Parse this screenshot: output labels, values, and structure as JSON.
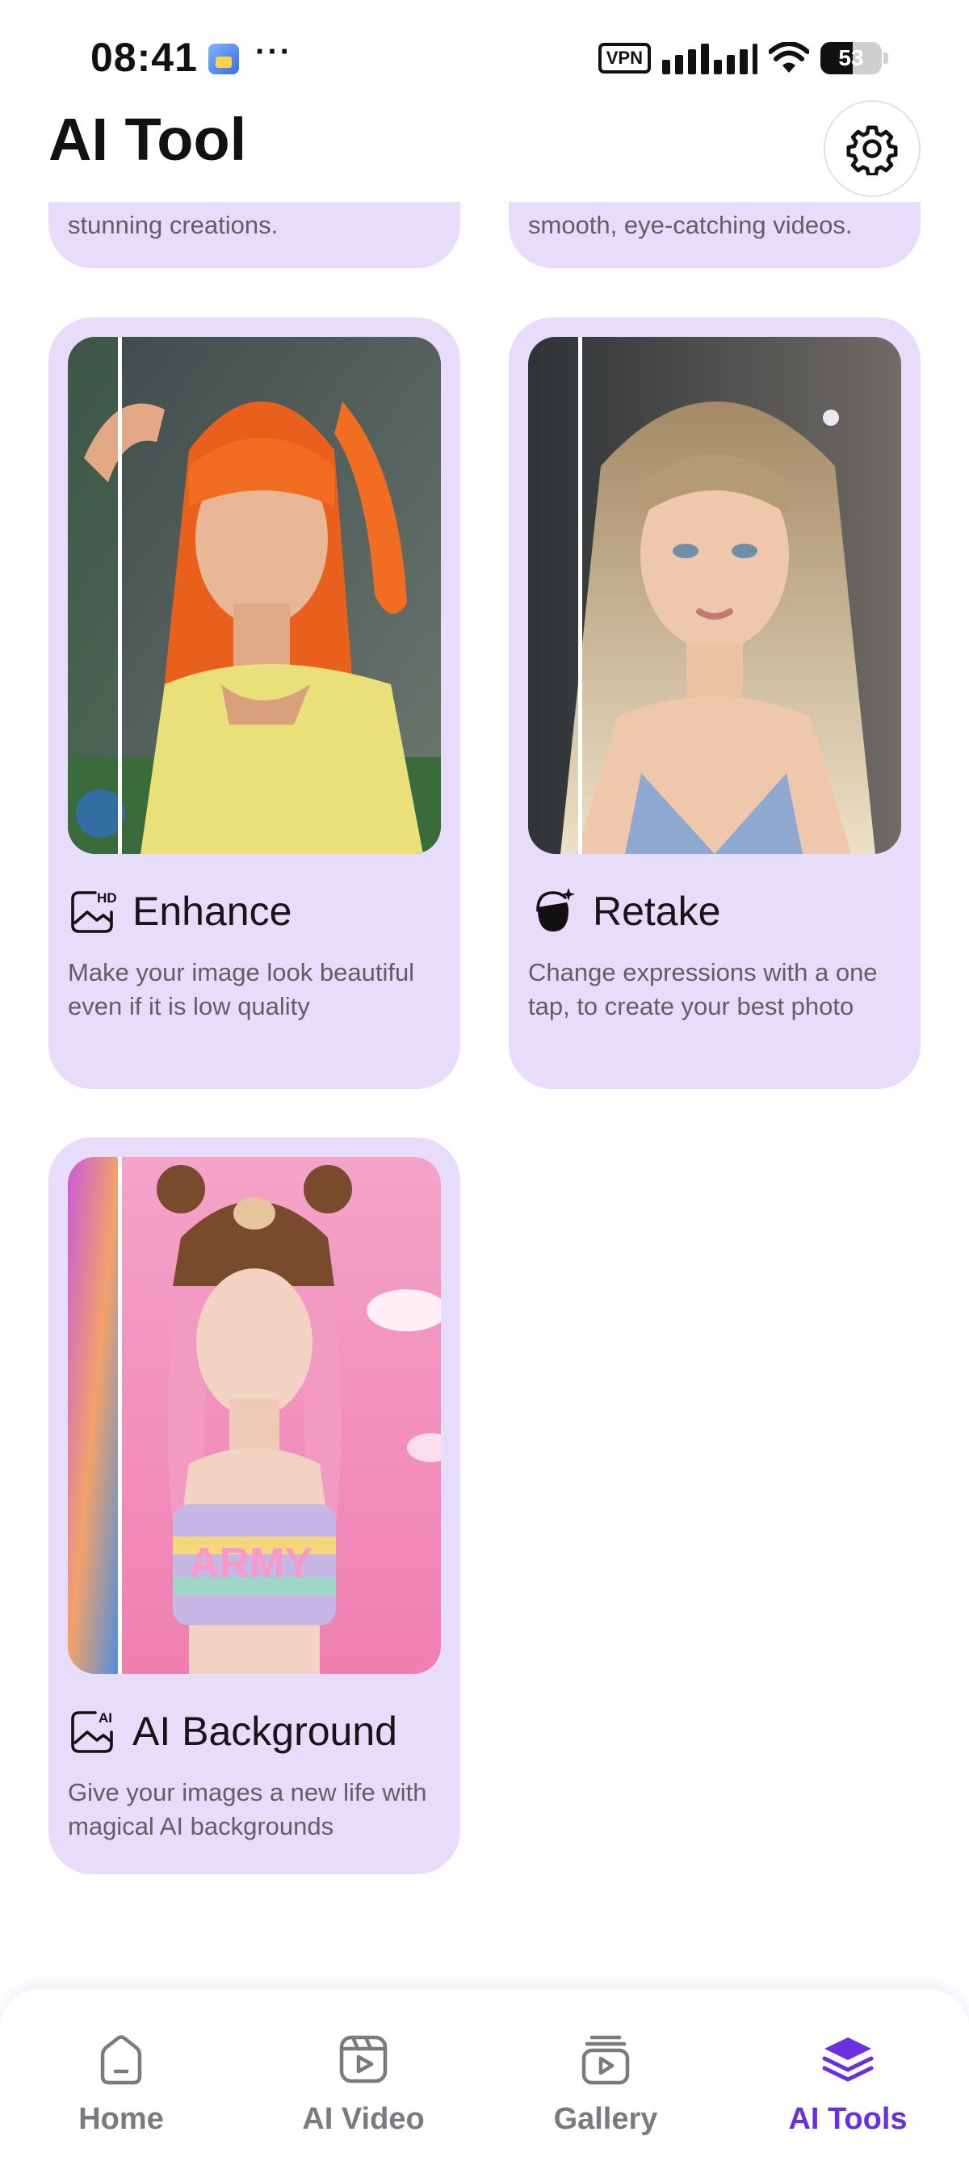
{
  "status_bar": {
    "time": "08:41",
    "more": "···",
    "vpn": "VPN",
    "battery": "53",
    "battery_level": 0.53
  },
  "header": {
    "title": "AI Tool",
    "settings_icon": "gear-icon"
  },
  "tools_partial": [
    {
      "description_tail": "stunning creations."
    },
    {
      "description_tail": "smooth, eye-catching videos."
    }
  ],
  "tools": [
    {
      "icon": "hd-image-icon",
      "title": "Enhance",
      "description": "Make your image look beautiful even if it is low quality"
    },
    {
      "icon": "face-sparkle-icon",
      "title": "Retake",
      "description": "Change expressions with a one tap, to create your best photo"
    },
    {
      "icon": "ai-image-icon",
      "title": "AI Background",
      "description": "Give your images a new life with magical AI backgrounds"
    }
  ],
  "bottom_nav": {
    "items": [
      {
        "label": "Home",
        "icon": "home-icon",
        "active": false
      },
      {
        "label": "AI Video",
        "icon": "video-play-icon",
        "active": false
      },
      {
        "label": "Gallery",
        "icon": "gallery-icon",
        "active": false
      },
      {
        "label": "AI Tools",
        "icon": "layers-icon",
        "active": true
      }
    ]
  },
  "colors": {
    "card_background": "#e7ddfa",
    "accent": "#6a2fe0",
    "inactive_nav": "#7a7a80"
  }
}
